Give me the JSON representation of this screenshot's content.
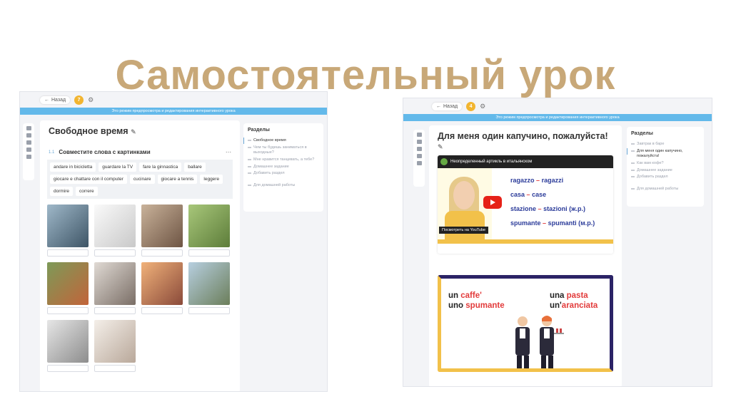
{
  "title": "Самостоятельный урок",
  "shot1": {
    "back_label": "Назад",
    "badge": "7",
    "banner": "Это режим предпросмотра и редактирования интерактивного урока",
    "heading": "Свободное время",
    "task_number": "1.1",
    "task_title": "Совместите слова с картинками",
    "words": [
      "andare in bicicletta",
      "guardare la TV",
      "fare la ginnastica",
      "ballare",
      "giocare e chattare con il computer",
      "cucinare",
      "giocare a tennis",
      "leggere",
      "dormire",
      "correre"
    ],
    "sections": {
      "header": "Разделы",
      "items": [
        "Свободное время",
        "Чем ты будешь заниматься в выходные?",
        "Мне нравится танцевать, а тебе?",
        "Домашнее задание",
        "Добавить раздел",
        "Для домашней работы"
      ]
    }
  },
  "shot2": {
    "back_label": "Назад",
    "badge": "4",
    "banner": "Это режим предпросмотра и редактирования интерактивного урока",
    "heading": "Для меня один капучино, пожалуйста!",
    "video_title": "Неопределенный артикль в итальянском",
    "video_lines": [
      {
        "a": "ragazzo",
        "b": "ragazzi"
      },
      {
        "a": "casa",
        "b": "case"
      },
      {
        "a": "stazione",
        "b": "stazioni (ж.р.)"
      },
      {
        "a": "spumante",
        "b": "spumanti (м.р.)"
      }
    ],
    "watch_on": "Посмотреть на YouTube",
    "card_left_1a": "un ",
    "card_left_1b": "caffe'",
    "card_left_2a": "uno ",
    "card_left_2b": "spumante",
    "card_right_1a": "una ",
    "card_right_1b": "pasta",
    "card_right_2a": "un'",
    "card_right_2b": "aranciata",
    "sections": {
      "header": "Разделы",
      "items": [
        "Завтрак в баре",
        "Для меня один капучино, пожалуйста!",
        "Как вам кофе?",
        "Домашнее задание",
        "Добавить раздел",
        "Для домашней работы"
      ]
    }
  },
  "colors": {
    "title": "#c8a878",
    "banner": "#63b9ea",
    "accent": "#f2c14a",
    "navy": "#2b2366"
  }
}
